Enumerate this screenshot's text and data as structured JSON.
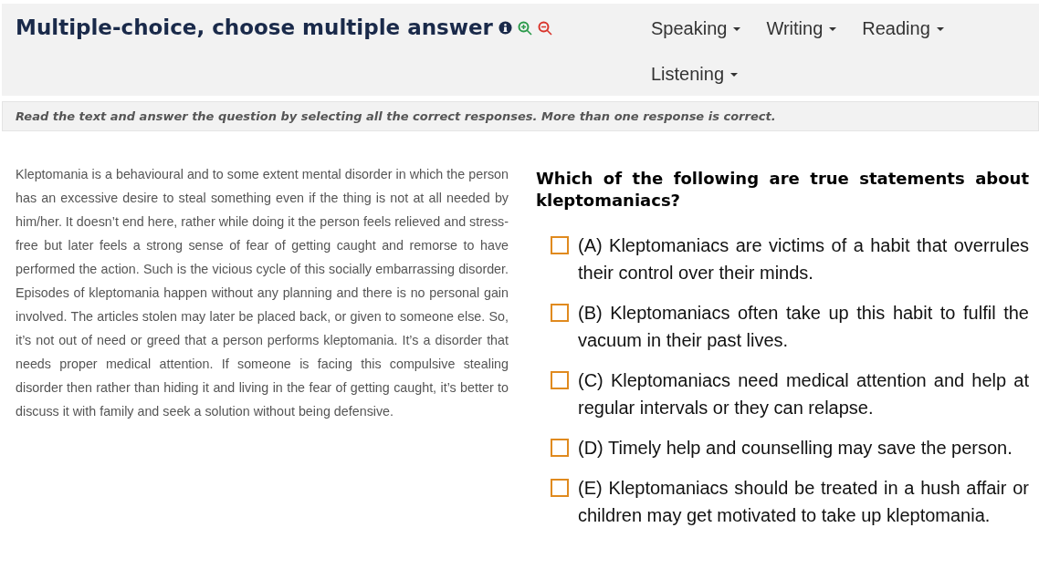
{
  "header": {
    "title": "Multiple-choice, choose multiple answer",
    "nav": [
      {
        "label": "Speaking"
      },
      {
        "label": "Writing"
      },
      {
        "label": "Reading"
      },
      {
        "label": "Listening"
      }
    ]
  },
  "instruction": "Read the text and answer the question by selecting all the correct responses. More than one response is correct.",
  "passage": "Kleptomania is a behavioural and to some extent mental disorder in which the person has an excessive desire to steal something even if the thing is not at all needed by him/her. It doesn’t end here, rather while doing it the person feels relieved and stress-free but later feels a strong sense of fear of getting caught and remorse to have performed the action. Such is the vicious cycle of this socially embarrassing disorder. Episodes of kleptomania happen without any planning and there is no personal gain involved. The articles stolen may later be placed back, or given to someone else. So, it’s not out of need or greed that a person performs kleptomania. It’s a disorder that needs proper medical attention. If someone is facing this compulsive stealing disorder then rather than hiding it and living in the fear of getting caught, it’s better to discuss it with family and seek a solution without being defensive.",
  "question": "Which of the following are true statements about kleptomaniacs?",
  "options": [
    {
      "text": "(A) Kleptomaniacs are victims of a habit that overrules their control over their minds.",
      "checked": false
    },
    {
      "text": "(B) Kleptomaniacs often take up this habit to fulfil the vacuum in their past lives.",
      "checked": false
    },
    {
      "text": "(C) Kleptomaniacs need medical attention and help at regular intervals or they can relapse.",
      "checked": false
    },
    {
      "text": "(D) Timely help and counselling may save the person.",
      "checked": false
    },
    {
      "text": "(E) Kleptomaniacs should be treated in a hush affair or children may get motivated to take up kleptomania.",
      "checked": false
    }
  ]
}
